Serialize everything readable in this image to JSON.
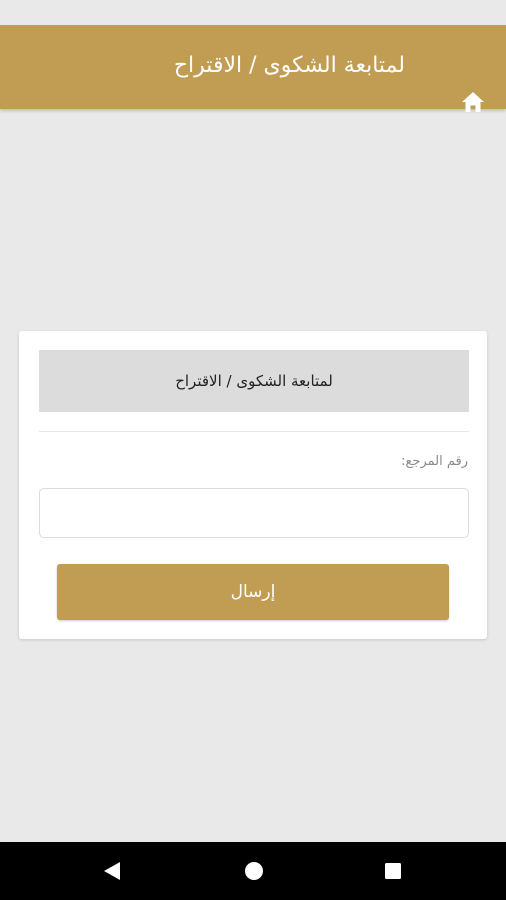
{
  "app_bar": {
    "title": "لمتابعة الشكوى / الاقتراح",
    "home_icon": "home-icon",
    "background": "#c19c53"
  },
  "form": {
    "header": "لمتابعة الشكوى / الاقتراح",
    "reference_label": "رقم المرجع:",
    "reference_value": "",
    "submit_label": "إرسال",
    "accent": "#c19c53"
  },
  "nav_bar": {
    "back_icon": "back-triangle-icon",
    "home_icon": "home-circle-icon",
    "recents_icon": "recents-square-icon"
  }
}
